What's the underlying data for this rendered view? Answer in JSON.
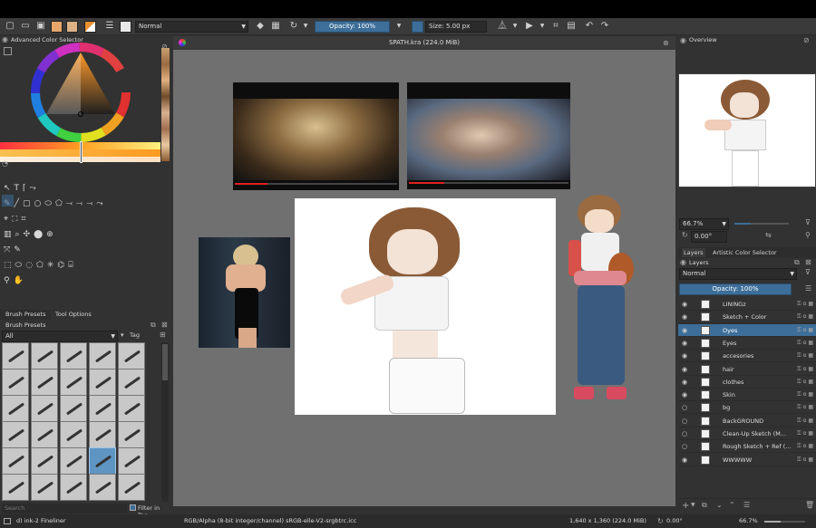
{
  "toolbar": {
    "blend_mode": "Normal",
    "opacity_label": "Opacity: 100%",
    "size_label": "Size: 5.00 px"
  },
  "color_selector": {
    "title": "Advanced Color Selector"
  },
  "document": {
    "title": "SPATH.kra (224.0 MiB)"
  },
  "overview": {
    "title": "Overview",
    "zoom": "66.7%",
    "rotation": "0.00°"
  },
  "tabs": {
    "layers_tab": "Layers",
    "artistic_tab": "Artistic Color Selector"
  },
  "layers": {
    "title": "Layers",
    "blend_mode": "Normal",
    "opacity_label": "Opacity: 100%",
    "items": [
      {
        "name": "LININGz",
        "active": false
      },
      {
        "name": "Sketch + Color",
        "active": false
      },
      {
        "name": "Oyes",
        "active": true
      },
      {
        "name": "Eyes",
        "active": false
      },
      {
        "name": "accesories",
        "active": false
      },
      {
        "name": "hair",
        "active": false
      },
      {
        "name": "clothes",
        "active": false
      },
      {
        "name": "Skin",
        "active": false
      },
      {
        "name": "bg",
        "active": false
      },
      {
        "name": "BackGROUND",
        "active": false
      },
      {
        "name": "Clean-Up Sketch (M...",
        "active": false
      },
      {
        "name": "Rough Sketch + Ref (...",
        "active": false
      },
      {
        "name": "WWWWW",
        "active": false
      }
    ]
  },
  "brush_tabs": {
    "presets_tab": "Brush Presets",
    "tool_options_tab": "Tool Options"
  },
  "brush_presets": {
    "title": "Brush Presets",
    "filter_value": "All",
    "tag_label": "Tag",
    "search_placeholder": "Search",
    "filter_in_tag": "Filter in Tag"
  },
  "status": {
    "brush_name": "d) ink-2 Fineliner",
    "color_info": "RGB/Alpha (8-bit integer/channel)  sRGB-elle-V2-srgbtrc.icc",
    "dimensions": "1,640 x 1,360 (224.0 MiB)",
    "rotation": "0.00°",
    "zoom": "66.7%"
  },
  "colors": {
    "accent": "#3d6e99",
    "panel_bg": "#323232",
    "canvas_bg": "#707070"
  }
}
